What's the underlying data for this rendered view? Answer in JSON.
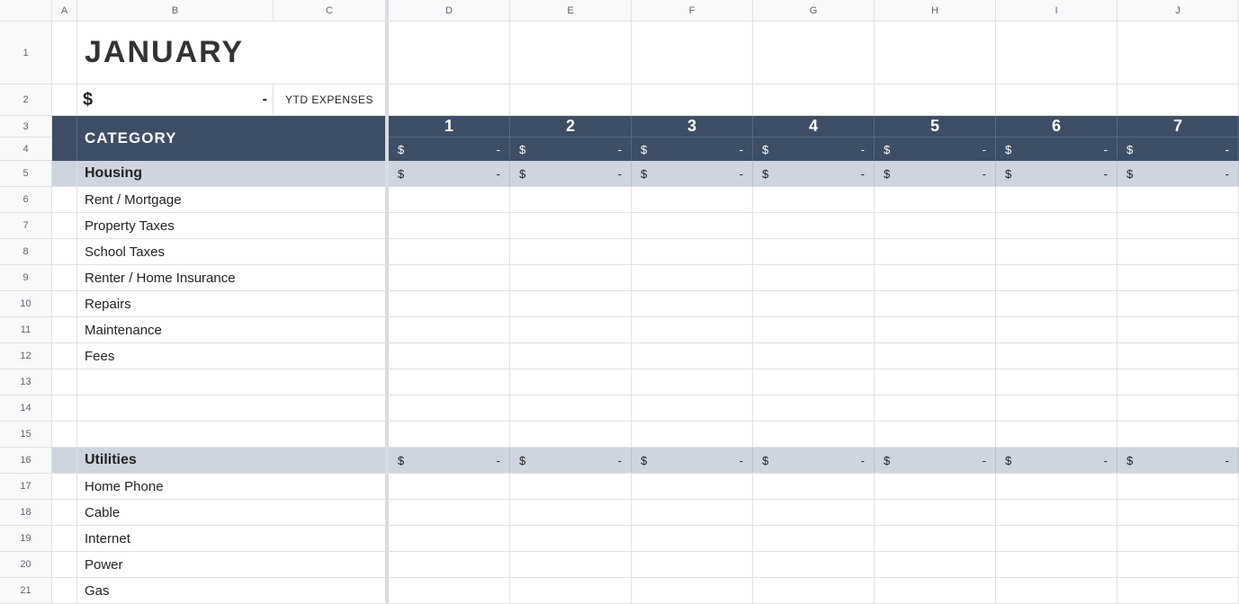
{
  "columns": [
    "A",
    "B",
    "C",
    "D",
    "E",
    "F",
    "G",
    "H",
    "I",
    "J"
  ],
  "rows": [
    "1",
    "2",
    "3",
    "4",
    "5",
    "6",
    "7",
    "8",
    "9",
    "10",
    "11",
    "12",
    "13",
    "14",
    "15",
    "16",
    "17",
    "18",
    "19",
    "20",
    "21"
  ],
  "title": "JANUARY",
  "ytd": {
    "symbol": "$",
    "value": "-",
    "label": "YTD EXPENSES"
  },
  "category_header": "CATEGORY",
  "days": [
    "1",
    "2",
    "3",
    "4",
    "5",
    "6",
    "7"
  ],
  "day_totals": {
    "symbol": "$",
    "value": "-"
  },
  "sections": [
    {
      "name": "Housing",
      "totals": {
        "symbol": "$",
        "value": "-"
      },
      "items": [
        "Rent / Mortgage",
        "Property Taxes",
        "School Taxes",
        "Renter / Home Insurance",
        "Repairs",
        "Maintenance",
        "Fees",
        "",
        "",
        ""
      ]
    },
    {
      "name": "Utilities",
      "totals": {
        "symbol": "$",
        "value": "-"
      },
      "items": [
        "Home Phone",
        "Cable",
        "Internet",
        "Power",
        "Gas"
      ]
    }
  ]
}
